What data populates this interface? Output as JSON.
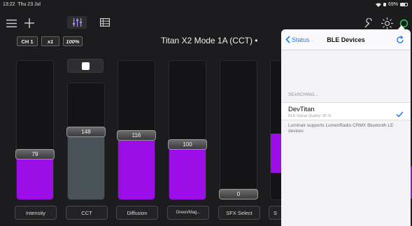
{
  "status_bar": {
    "time": "13:22",
    "date": "Thu 23 Jul",
    "battery": "69%"
  },
  "toolbar": {
    "left_icons": [
      "menu-icon",
      "plus-icon",
      "sliders-icon",
      "table-icon"
    ],
    "right_icons": [
      "wrench-icon",
      "sun-icon",
      "power-icon"
    ],
    "accent": "#30d158"
  },
  "channel": {
    "channel": "CH 1",
    "multiplier": "x1",
    "intensity": "100%"
  },
  "mode_title": "Titan X2 Mode 1A (CCT) •",
  "faders": [
    {
      "label": "Intensity",
      "value": "79"
    },
    {
      "label": "CCT",
      "value": "148"
    },
    {
      "label": "Diffusion",
      "value": "116"
    },
    {
      "label": "Green/Mag...",
      "value": "100"
    },
    {
      "label": "SFX Select",
      "value": "0"
    },
    {
      "label": "S"
    }
  ],
  "colors": {
    "fill": "#9b0ee8",
    "cct_fill": "#4a5358",
    "link": "#1a7cf5"
  },
  "ble_popover": {
    "back_label": "Status",
    "title": "BLE Devices",
    "section_label": "SEARCHING...",
    "device": {
      "name": "DevTitan",
      "signal": "BLE Signal Quality: 96 %",
      "selected": true
    },
    "footer": "Luminair supports LumenRadio CRMX Bluetooth LE devices"
  }
}
